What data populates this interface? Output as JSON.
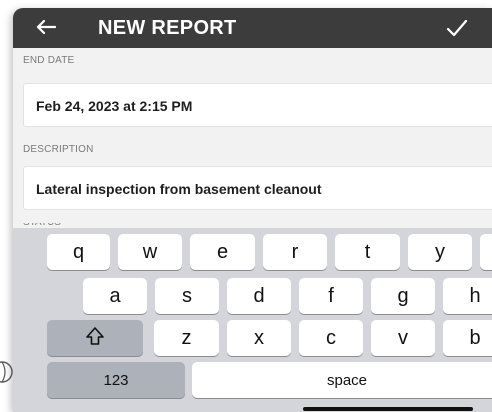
{
  "header": {
    "title": "NEW REPORT",
    "back_icon": "arrow-left-icon",
    "confirm_icon": "checkmark-icon"
  },
  "form": {
    "end_date": {
      "label": "END DATE",
      "value": "Feb 24, 2023 at 2:15 PM"
    },
    "description": {
      "label": "DESCRIPTION",
      "value": "Lateral inspection from basement cleanout"
    },
    "status": {
      "label": "STATUS"
    }
  },
  "keyboard": {
    "row1": [
      "q",
      "w",
      "e",
      "r",
      "t",
      "y"
    ],
    "row2": [
      "a",
      "s",
      "d",
      "f",
      "g",
      "h"
    ],
    "row3": [
      "z",
      "x",
      "c",
      "v",
      "b"
    ],
    "shift_icon": "shift-icon",
    "numbers_label": "123",
    "space_label": "space",
    "globe_icon": "globe-icon"
  }
}
